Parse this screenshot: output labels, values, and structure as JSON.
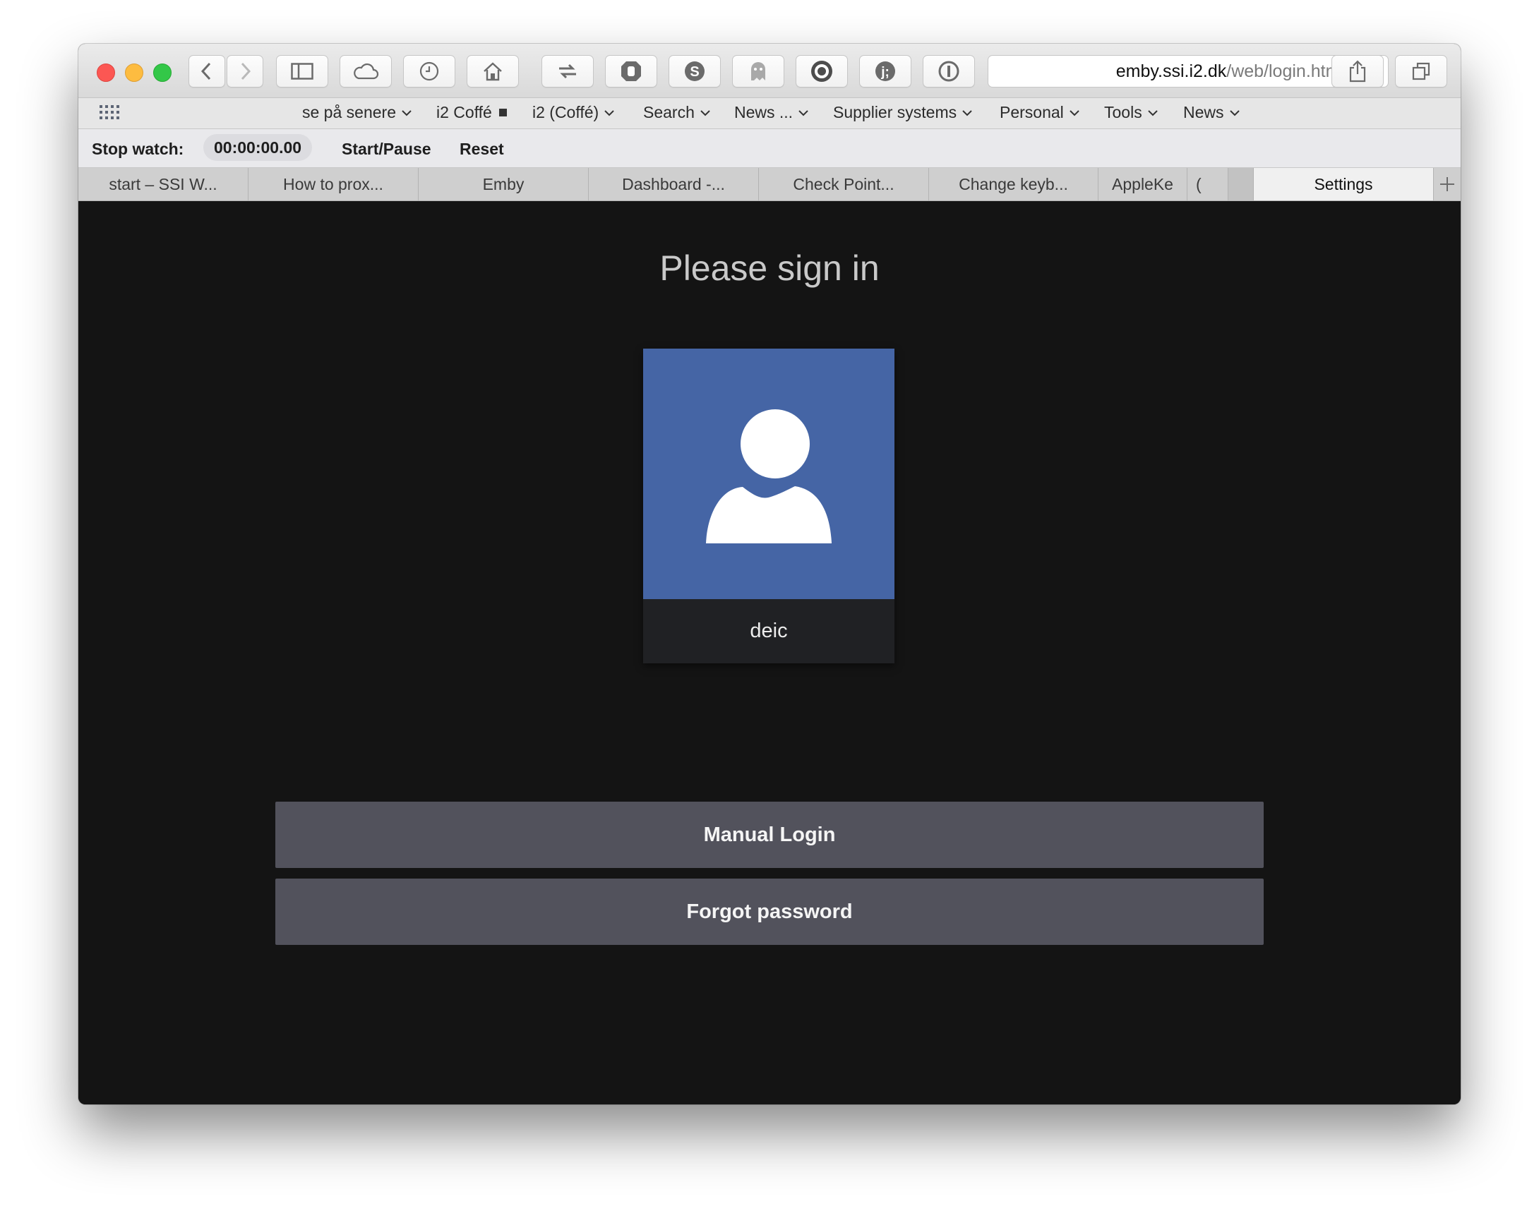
{
  "browser": {
    "url_host": "emby.ssi.i2.dk",
    "url_path": "/web/login.html"
  },
  "bookmarks": [
    {
      "label": "se på senere",
      "chevron": true
    },
    {
      "label": "i2 Coffé",
      "square": true
    },
    {
      "label": "i2 (Coffé)",
      "chevron": true
    },
    {
      "label": "Search",
      "chevron": true
    },
    {
      "label": "News ...",
      "chevron": true
    },
    {
      "label": "Supplier systems",
      "chevron": true
    },
    {
      "label": "Personal",
      "chevron": true
    },
    {
      "label": "Tools",
      "chevron": true
    },
    {
      "label": "News",
      "chevron": true
    }
  ],
  "stopwatch": {
    "label": "Stop watch:",
    "time": "00:00:00.00",
    "start_pause": "Start/Pause",
    "reset": "Reset"
  },
  "tabs": [
    {
      "label": "start – SSI W..."
    },
    {
      "label": "How to prox..."
    },
    {
      "label": "Emby"
    },
    {
      "label": "Dashboard -..."
    },
    {
      "label": "Check Point..."
    },
    {
      "label": "Change keyb..."
    },
    {
      "label": "AppleKe"
    },
    {
      "label": "("
    },
    {
      "label": ""
    },
    {
      "label": "Settings",
      "active": true
    }
  ],
  "page": {
    "title": "Please sign in",
    "user": {
      "name": "deic"
    },
    "manual_login": "Manual Login",
    "forgot_password": "Forgot password"
  },
  "colors": {
    "page_bg": "#141414",
    "avatar_bg": "#4565a5",
    "button_bg": "#52525c"
  }
}
